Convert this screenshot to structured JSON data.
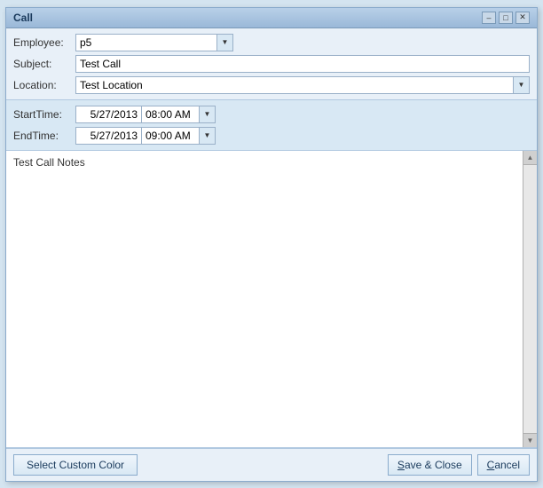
{
  "dialog": {
    "title": "Call",
    "title_extra": ""
  },
  "title_controls": {
    "minimize": "–",
    "maximize": "□",
    "close": "✕"
  },
  "form": {
    "employee_label": "Employee:",
    "employee_value": "p5",
    "subject_label": "Subject:",
    "subject_value": "Test Call",
    "location_label": "Location:",
    "location_value": "Test Location"
  },
  "times": {
    "start_label": "StartTime:",
    "start_date": "5/27/2013",
    "start_time": "08:00 AM",
    "end_label": "EndTime:",
    "end_date": "5/27/2013",
    "end_time": "09:00 AM"
  },
  "notes": {
    "value": "Test Call Notes"
  },
  "footer": {
    "select_color_label": "Select Custom Color",
    "save_close_label": "Save & Close",
    "save_close_underline": "S",
    "cancel_label": "Cancel",
    "cancel_underline": "C"
  },
  "scrollbar": {
    "up_arrow": "▲",
    "down_arrow": "▼"
  },
  "dropdown_arrow": "▼"
}
